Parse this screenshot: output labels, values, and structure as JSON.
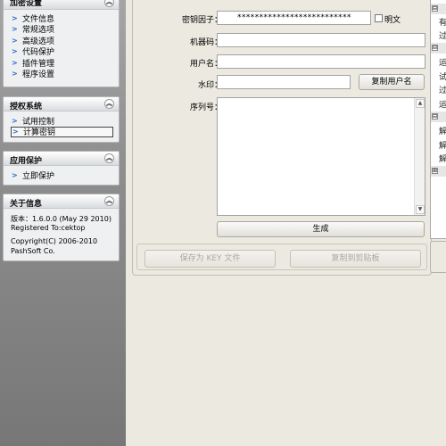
{
  "sidebar": {
    "encrypt_settings": {
      "title": "加密设置",
      "items": [
        "文件信息",
        "常规选项",
        "高级选项",
        "代码保护",
        "插件管理",
        "程序设置"
      ]
    },
    "license_system": {
      "title": "授权系统",
      "items": [
        "试用控制",
        "计算密钥"
      ],
      "selected": "计算密钥"
    },
    "app_protect": {
      "title": "应用保护",
      "items": [
        "立即保护"
      ]
    },
    "about": {
      "title": "关于信息",
      "version": "版本：1.6.0.0 (May 29 2010)",
      "registered": "Registered To:cektop",
      "copyright": "Copyright(C) 2006-2010",
      "company": "PashSoft Co."
    }
  },
  "form": {
    "key_factor_label": "密钥因子：",
    "key_factor_value": "**************************",
    "show_plain_label": "明文",
    "machine_code_label": "机器码：",
    "machine_code_value": "",
    "username_label": "用户名：",
    "username_value": "",
    "watermark_label": "水印：",
    "watermark_value": "",
    "copy_username_btn": "复制用户名",
    "serial_label": "序列号：",
    "serial_value": "",
    "generate_btn": "生成",
    "save_key_btn": "保存为 KEY 文件",
    "copy_clipboard_btn": "复制到剪贴板"
  },
  "right_panel": {
    "rows": [
      "有",
      "过",
      "运",
      "试",
      "过",
      "运",
      "解",
      "解",
      "解"
    ],
    "groups": [
      "⊟",
      "⊟",
      "⊟",
      "⊟",
      "⊞"
    ]
  }
}
